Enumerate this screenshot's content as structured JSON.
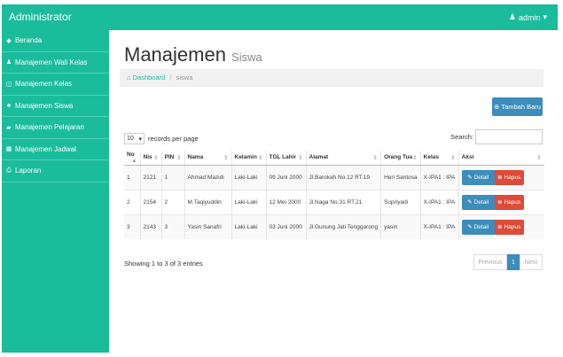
{
  "app": {
    "brand": "Administrator",
    "user_label": "admin",
    "user_caret": "▾"
  },
  "sidebar": {
    "items": [
      {
        "icon": "dashboard-icon",
        "glyph": "◆",
        "label": "Beranda"
      },
      {
        "icon": "user-icon",
        "glyph": "♟",
        "label": "Manajemen Wali Kelas"
      },
      {
        "icon": "columns-icon",
        "glyph": "◫",
        "label": "Manajemen Kelas"
      },
      {
        "icon": "users-icon",
        "glyph": "♣",
        "label": "Manajemen Siswa"
      },
      {
        "icon": "book-icon",
        "glyph": "▰",
        "label": "Manajemen Pelajaran"
      },
      {
        "icon": "calendar-icon",
        "glyph": "▦",
        "label": "Manajemen Jadwal"
      },
      {
        "icon": "print-icon",
        "glyph": "⎙",
        "label": "Laporan"
      }
    ]
  },
  "page": {
    "title": "Manajemen",
    "subtitle": "Siswa"
  },
  "breadcrumb": {
    "home": "Dashboard",
    "separator": "/",
    "current": "siswa"
  },
  "add_button": {
    "icon": "plus-circle-icon",
    "label": "Tambah Baru"
  },
  "length_control": {
    "value": "10",
    "suffix": "records per page"
  },
  "search": {
    "label": "Search:",
    "value": ""
  },
  "table": {
    "headers": [
      "No",
      "Nis",
      "PIN",
      "Nama",
      "Kelamin",
      "TGL Lahir",
      "Alamat",
      "Orang Tua",
      "Kelas",
      "Aksi"
    ],
    "rows": [
      [
        "1",
        "2121",
        "1",
        "Ahmad Mazidi",
        "Laki-Laki",
        "09 Juni 2000",
        "Jl.Barokah No.12 RT.19",
        "Heri Santosa",
        "X-IPA1 : IPA"
      ],
      [
        "2",
        "2154",
        "2",
        "M.Taqiyuddin",
        "Laki-Laki",
        "12 Mei 2000",
        "Jl.Naga No.31 RT.21",
        "Supriyadi",
        "X-IPA1 : IPA"
      ],
      [
        "3",
        "2143",
        "3",
        "Yasin Sanafri",
        "Laki-Laki",
        "03 Juni 2000",
        "Jl.Gunung Jati Tenggarong",
        "yasin",
        "X-IPA1 : IPA"
      ]
    ],
    "detail_label": "Detail",
    "hapus_label": "Hapus"
  },
  "footer": {
    "info": "Showing 1 to 3 of 3 entries",
    "prev": "Previous",
    "page": "1",
    "next": "Next"
  },
  "colors": {
    "brand": "#1abc9c",
    "primary": "#3c8dbc",
    "danger": "#dd4b39"
  }
}
